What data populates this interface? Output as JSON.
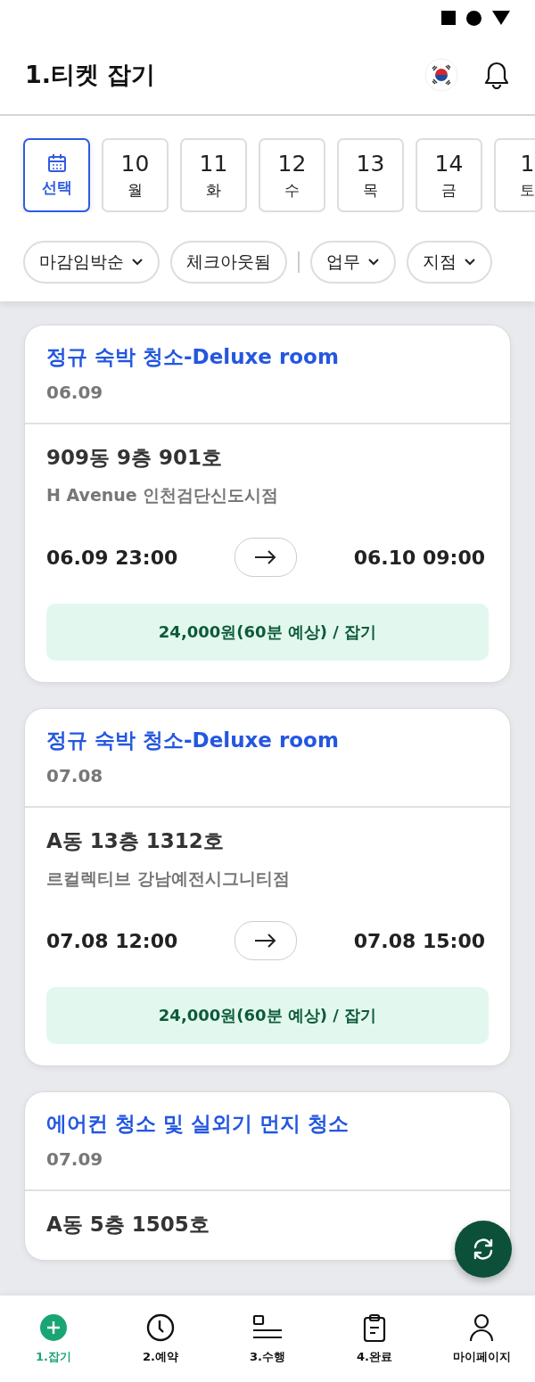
{
  "header": {
    "title": "1.티켓 잡기"
  },
  "date_strip": {
    "picker_label": "선택",
    "picker_selected": true,
    "days": [
      {
        "day": "10",
        "weekday": "월",
        "selected": false
      },
      {
        "day": "11",
        "weekday": "화",
        "selected": false
      },
      {
        "day": "12",
        "weekday": "수",
        "selected": false
      },
      {
        "day": "13",
        "weekday": "목",
        "selected": false
      },
      {
        "day": "14",
        "weekday": "금",
        "selected": false
      },
      {
        "day": "1",
        "weekday": "토",
        "selected": false
      }
    ]
  },
  "filters": [
    {
      "label": "마감임박순",
      "kind": "dropdown"
    },
    {
      "label": "체크아웃됨",
      "kind": "toggle"
    },
    {
      "kind": "divider"
    },
    {
      "label": "업무",
      "kind": "dropdown"
    },
    {
      "label": "지점",
      "kind": "dropdown"
    }
  ],
  "tickets": [
    {
      "title": "정규 숙박 청소-Deluxe room",
      "date": "06.09",
      "room": "909동 9층 901호",
      "branch": "H Avenue 인천검단신도시점",
      "start": "06.09 23:00",
      "end": "06.10 09:00",
      "action": "24,000원(60분 예상) / 잡기"
    },
    {
      "title": "정규 숙박 청소-Deluxe room",
      "date": "07.08",
      "room": "A동 13층 1312호",
      "branch": "르컬렉티브 강남예전시그니티점",
      "start": "07.08 12:00",
      "end": "07.08 15:00",
      "action": "24,000원(60분 예상) / 잡기"
    },
    {
      "title": "에어컨 청소 및 실외기 먼지 청소",
      "date": "07.09",
      "room": "A동 5층 1505호"
    }
  ],
  "nav": [
    {
      "label": "1.잡기",
      "kind": "grab",
      "selected": true
    },
    {
      "label": "2.예약",
      "kind": "reserve",
      "selected": false
    },
    {
      "label": "3.수행",
      "kind": "perform",
      "selected": false
    },
    {
      "label": "4.완료",
      "kind": "done",
      "selected": false
    },
    {
      "label": "마이페이지",
      "kind": "mypage",
      "selected": false
    }
  ]
}
